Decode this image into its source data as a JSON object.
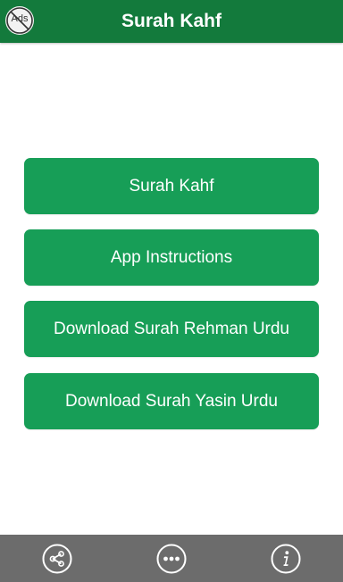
{
  "header": {
    "title": "Surah Kahf",
    "no_ads_label": "Ads",
    "no_ads_icon": "no-ads-icon"
  },
  "menu": {
    "items": [
      {
        "label": "Surah Kahf"
      },
      {
        "label": "App Instructions"
      },
      {
        "label": "Download Surah Rehman Urdu"
      },
      {
        "label": "Download Surah Yasin Urdu"
      }
    ]
  },
  "bottom_bar": {
    "icons": [
      "share-icon",
      "more-icon",
      "info-icon"
    ]
  },
  "colors": {
    "header": "#137a3c",
    "button": "#179e57",
    "bottom_bar": "#6c6c6c",
    "text": "#ffffff"
  }
}
